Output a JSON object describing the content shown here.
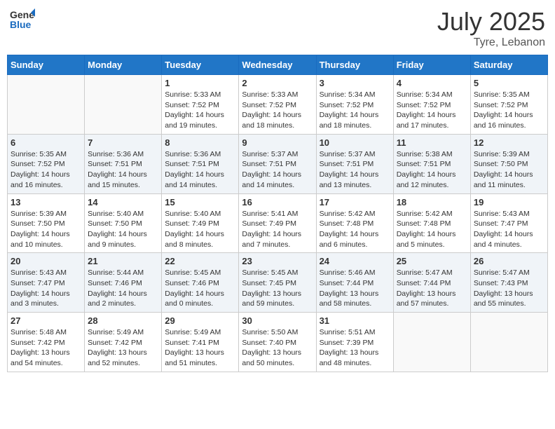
{
  "header": {
    "logo_general": "General",
    "logo_blue": "Blue",
    "month": "July 2025",
    "location": "Tyre, Lebanon"
  },
  "days_of_week": [
    "Sunday",
    "Monday",
    "Tuesday",
    "Wednesday",
    "Thursday",
    "Friday",
    "Saturday"
  ],
  "weeks": [
    [
      {
        "day": "",
        "info": ""
      },
      {
        "day": "",
        "info": ""
      },
      {
        "day": "1",
        "info": "Sunrise: 5:33 AM\nSunset: 7:52 PM\nDaylight: 14 hours\nand 19 minutes."
      },
      {
        "day": "2",
        "info": "Sunrise: 5:33 AM\nSunset: 7:52 PM\nDaylight: 14 hours\nand 18 minutes."
      },
      {
        "day": "3",
        "info": "Sunrise: 5:34 AM\nSunset: 7:52 PM\nDaylight: 14 hours\nand 18 minutes."
      },
      {
        "day": "4",
        "info": "Sunrise: 5:34 AM\nSunset: 7:52 PM\nDaylight: 14 hours\nand 17 minutes."
      },
      {
        "day": "5",
        "info": "Sunrise: 5:35 AM\nSunset: 7:52 PM\nDaylight: 14 hours\nand 16 minutes."
      }
    ],
    [
      {
        "day": "6",
        "info": "Sunrise: 5:35 AM\nSunset: 7:52 PM\nDaylight: 14 hours\nand 16 minutes."
      },
      {
        "day": "7",
        "info": "Sunrise: 5:36 AM\nSunset: 7:51 PM\nDaylight: 14 hours\nand 15 minutes."
      },
      {
        "day": "8",
        "info": "Sunrise: 5:36 AM\nSunset: 7:51 PM\nDaylight: 14 hours\nand 14 minutes."
      },
      {
        "day": "9",
        "info": "Sunrise: 5:37 AM\nSunset: 7:51 PM\nDaylight: 14 hours\nand 14 minutes."
      },
      {
        "day": "10",
        "info": "Sunrise: 5:37 AM\nSunset: 7:51 PM\nDaylight: 14 hours\nand 13 minutes."
      },
      {
        "day": "11",
        "info": "Sunrise: 5:38 AM\nSunset: 7:51 PM\nDaylight: 14 hours\nand 12 minutes."
      },
      {
        "day": "12",
        "info": "Sunrise: 5:39 AM\nSunset: 7:50 PM\nDaylight: 14 hours\nand 11 minutes."
      }
    ],
    [
      {
        "day": "13",
        "info": "Sunrise: 5:39 AM\nSunset: 7:50 PM\nDaylight: 14 hours\nand 10 minutes."
      },
      {
        "day": "14",
        "info": "Sunrise: 5:40 AM\nSunset: 7:50 PM\nDaylight: 14 hours\nand 9 minutes."
      },
      {
        "day": "15",
        "info": "Sunrise: 5:40 AM\nSunset: 7:49 PM\nDaylight: 14 hours\nand 8 minutes."
      },
      {
        "day": "16",
        "info": "Sunrise: 5:41 AM\nSunset: 7:49 PM\nDaylight: 14 hours\nand 7 minutes."
      },
      {
        "day": "17",
        "info": "Sunrise: 5:42 AM\nSunset: 7:48 PM\nDaylight: 14 hours\nand 6 minutes."
      },
      {
        "day": "18",
        "info": "Sunrise: 5:42 AM\nSunset: 7:48 PM\nDaylight: 14 hours\nand 5 minutes."
      },
      {
        "day": "19",
        "info": "Sunrise: 5:43 AM\nSunset: 7:47 PM\nDaylight: 14 hours\nand 4 minutes."
      }
    ],
    [
      {
        "day": "20",
        "info": "Sunrise: 5:43 AM\nSunset: 7:47 PM\nDaylight: 14 hours\nand 3 minutes."
      },
      {
        "day": "21",
        "info": "Sunrise: 5:44 AM\nSunset: 7:46 PM\nDaylight: 14 hours\nand 2 minutes."
      },
      {
        "day": "22",
        "info": "Sunrise: 5:45 AM\nSunset: 7:46 PM\nDaylight: 14 hours\nand 0 minutes."
      },
      {
        "day": "23",
        "info": "Sunrise: 5:45 AM\nSunset: 7:45 PM\nDaylight: 13 hours\nand 59 minutes."
      },
      {
        "day": "24",
        "info": "Sunrise: 5:46 AM\nSunset: 7:44 PM\nDaylight: 13 hours\nand 58 minutes."
      },
      {
        "day": "25",
        "info": "Sunrise: 5:47 AM\nSunset: 7:44 PM\nDaylight: 13 hours\nand 57 minutes."
      },
      {
        "day": "26",
        "info": "Sunrise: 5:47 AM\nSunset: 7:43 PM\nDaylight: 13 hours\nand 55 minutes."
      }
    ],
    [
      {
        "day": "27",
        "info": "Sunrise: 5:48 AM\nSunset: 7:42 PM\nDaylight: 13 hours\nand 54 minutes."
      },
      {
        "day": "28",
        "info": "Sunrise: 5:49 AM\nSunset: 7:42 PM\nDaylight: 13 hours\nand 52 minutes."
      },
      {
        "day": "29",
        "info": "Sunrise: 5:49 AM\nSunset: 7:41 PM\nDaylight: 13 hours\nand 51 minutes."
      },
      {
        "day": "30",
        "info": "Sunrise: 5:50 AM\nSunset: 7:40 PM\nDaylight: 13 hours\nand 50 minutes."
      },
      {
        "day": "31",
        "info": "Sunrise: 5:51 AM\nSunset: 7:39 PM\nDaylight: 13 hours\nand 48 minutes."
      },
      {
        "day": "",
        "info": ""
      },
      {
        "day": "",
        "info": ""
      }
    ]
  ]
}
